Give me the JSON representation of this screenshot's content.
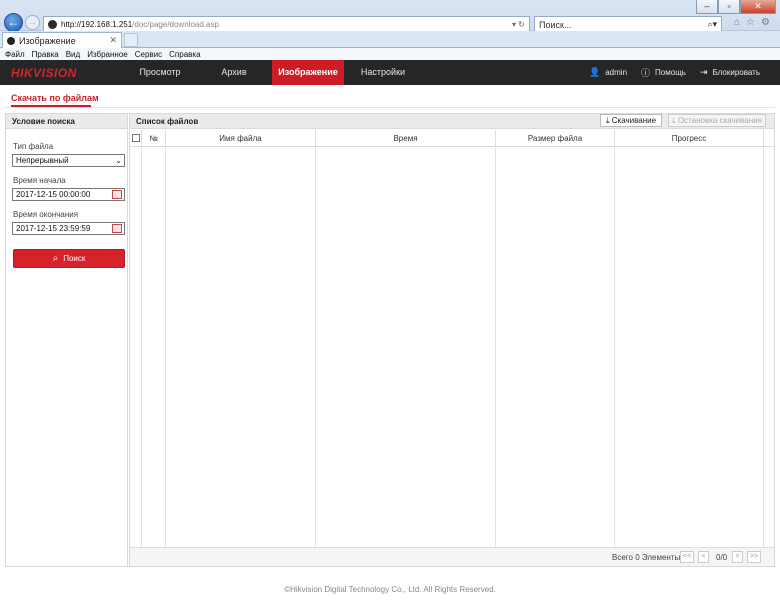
{
  "browser": {
    "url_host": "http://192.168.1.251",
    "url_path": "/doc/page/download.asp",
    "address_controls": "▾ ↻",
    "search_placeholder": "Поиск...",
    "tab_title": "Изображение",
    "menu": [
      "Файл",
      "Правка",
      "Вид",
      "Избранное",
      "Сервис",
      "Справка"
    ]
  },
  "app": {
    "logo": "HIKVISION",
    "nav": [
      "Просмотр",
      "Архив",
      "Изображение",
      "Настройки"
    ],
    "active_nav": "Изображение",
    "user": "admin",
    "help": "Помощь",
    "lock": "Блокировать",
    "accent_color": "#cc1d26"
  },
  "subtab": "Скачать по файлам",
  "search_panel": {
    "title": "Условие поиска",
    "file_type_label": "Тип файла",
    "file_type_value": "Непрерывный",
    "start_label": "Время начала",
    "start_value": "2017-12-15 00:00:00",
    "end_label": "Время окончания",
    "end_value": "2017-12-15 23:59:59",
    "search_button": "Поиск"
  },
  "file_list": {
    "title": "Список файлов",
    "download_button": "Скачивание",
    "stop_button": "Остановка скачивания",
    "columns": [
      "№",
      "Имя файла",
      "Время",
      "Размер файла",
      "Прогресс"
    ],
    "rows": [],
    "total_text": "Всего 0 Элементы",
    "page_text": "0/0",
    "pager_buttons": [
      "<<",
      "<",
      ">",
      ">>"
    ]
  },
  "footer": "©Hikvision Digital Technology Co., Ltd. All Rights Reserved."
}
